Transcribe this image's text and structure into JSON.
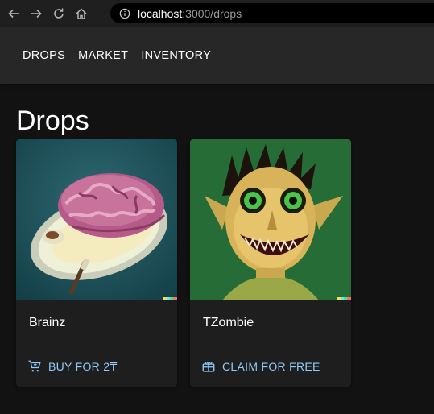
{
  "browser": {
    "url_host": "localhost",
    "url_path": ":3000/drops"
  },
  "nav": {
    "items": [
      "DROPS",
      "MARKET",
      "INVENTORY"
    ]
  },
  "page": {
    "title": "Drops"
  },
  "cards": [
    {
      "title": "Brainz",
      "action_label": "BUY FOR 2₸",
      "action_icon": "add-shopping-cart-icon",
      "image": "painting of a brain on a plate"
    },
    {
      "title": "TZombie",
      "action_label": "CLAIM FOR FREE",
      "action_icon": "redeem-gift-icon",
      "image": "painting of a grinning green-eyed zombie"
    }
  ],
  "colors": {
    "accent": "#90caf9",
    "app_bar": "#272727",
    "background": "#121212",
    "card": "#1e1e1e"
  }
}
